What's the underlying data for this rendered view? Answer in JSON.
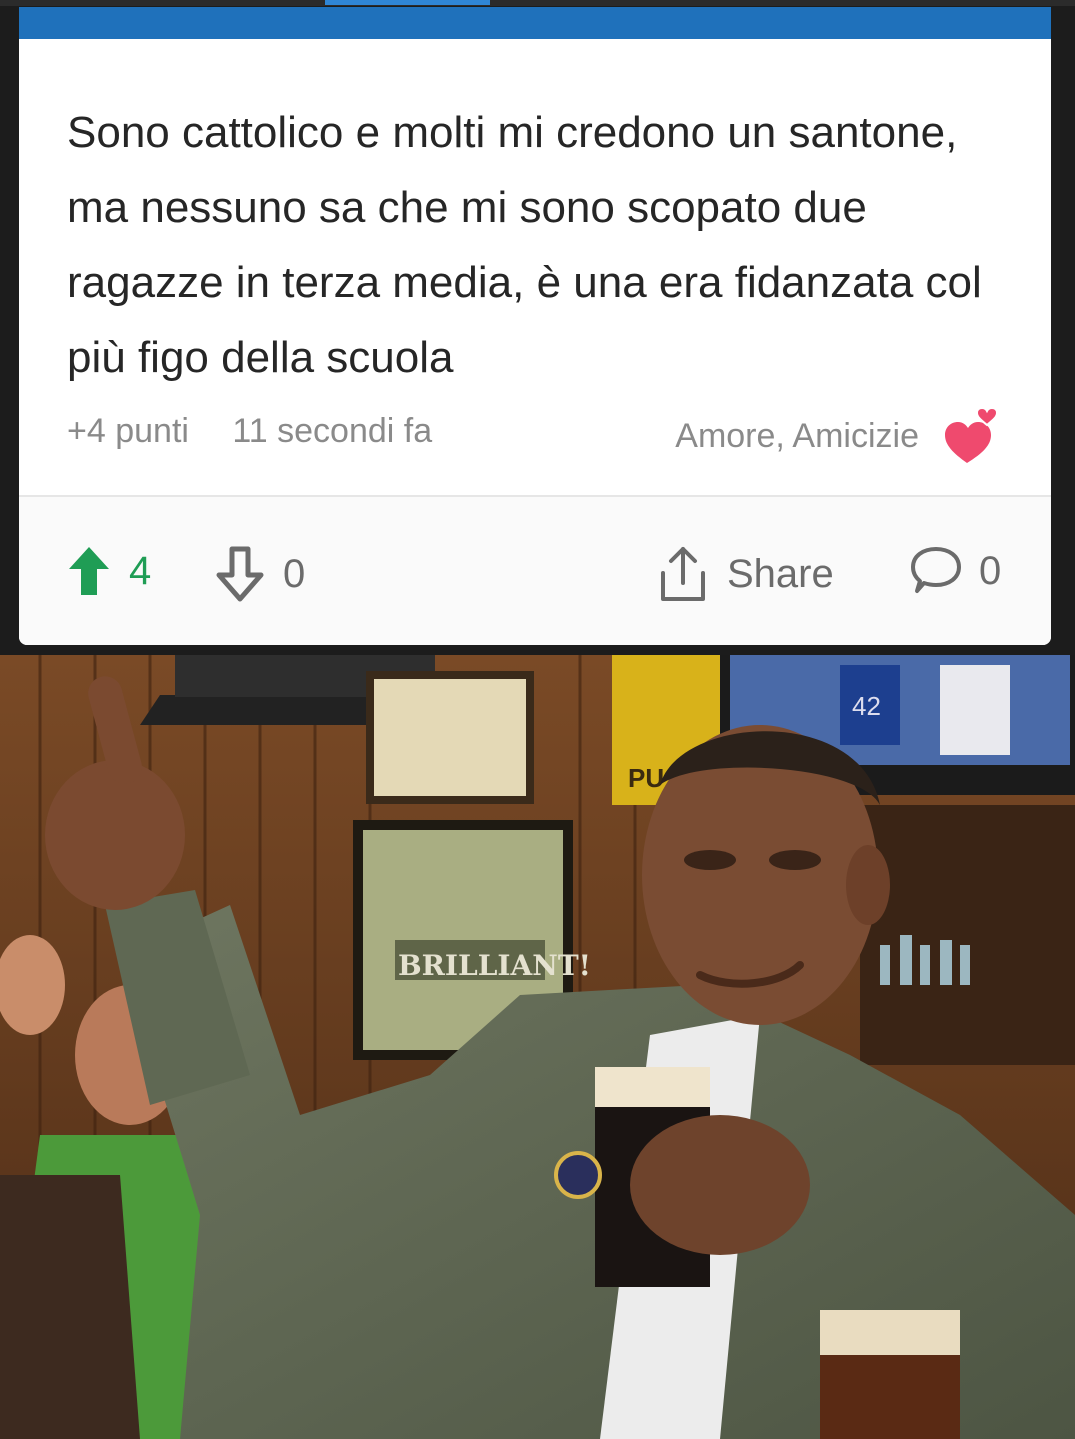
{
  "post": {
    "text": "Sono cattolico e molti mi credono un santone, ma nessuno sa che mi sono scopato due ragazze in terza media, è una era fidanzata col più figo della scuola",
    "points": "+4 punti",
    "time": "11 secondi fa",
    "category": "Amore, Amicizie",
    "category_icon": "heart-icon"
  },
  "actions": {
    "upvote_count": "4",
    "downvote_count": "0",
    "share_label": "Share",
    "comment_count": "0"
  },
  "image": {
    "poster_text": "BRILLIANT!",
    "tv_jersey_number": "42",
    "sign_text": "PU"
  },
  "colors": {
    "header_bar": "#1f71bb",
    "upvote": "#1f9d55",
    "heart": "#ef4a6e"
  }
}
